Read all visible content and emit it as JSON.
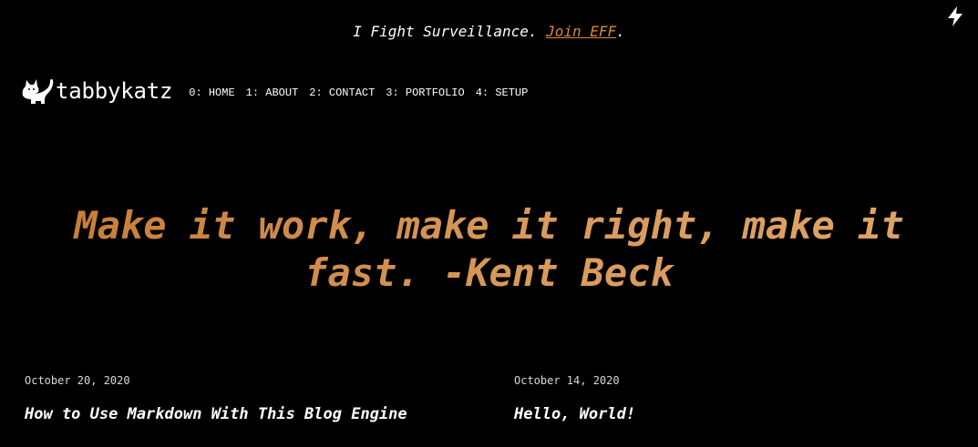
{
  "banner": {
    "text": "I Fight Surveillance. ",
    "link_label": "Join EFF",
    "suffix": "."
  },
  "theme_toggle": {
    "icon": "lightning-bolt-icon"
  },
  "site": {
    "logo_icon": "cat-icon",
    "name": "tabbykatz"
  },
  "nav": {
    "items": [
      {
        "label": "0: HOME"
      },
      {
        "label": "1: ABOUT"
      },
      {
        "label": "2: CONTACT"
      },
      {
        "label": "3: PORTFOLIO"
      },
      {
        "label": "4: SETUP"
      }
    ]
  },
  "hero": {
    "line1": "Make it work, make it right, make it",
    "line2": "fast. -Kent Beck"
  },
  "posts": [
    {
      "date": "October 20, 2020",
      "title": "How to Use Markdown With This Blog Engine"
    },
    {
      "date": "October 14, 2020",
      "title": "Hello, World!"
    }
  ],
  "colors": {
    "background": "#000000",
    "accent": "#c47a33",
    "text": "#ffffff"
  }
}
